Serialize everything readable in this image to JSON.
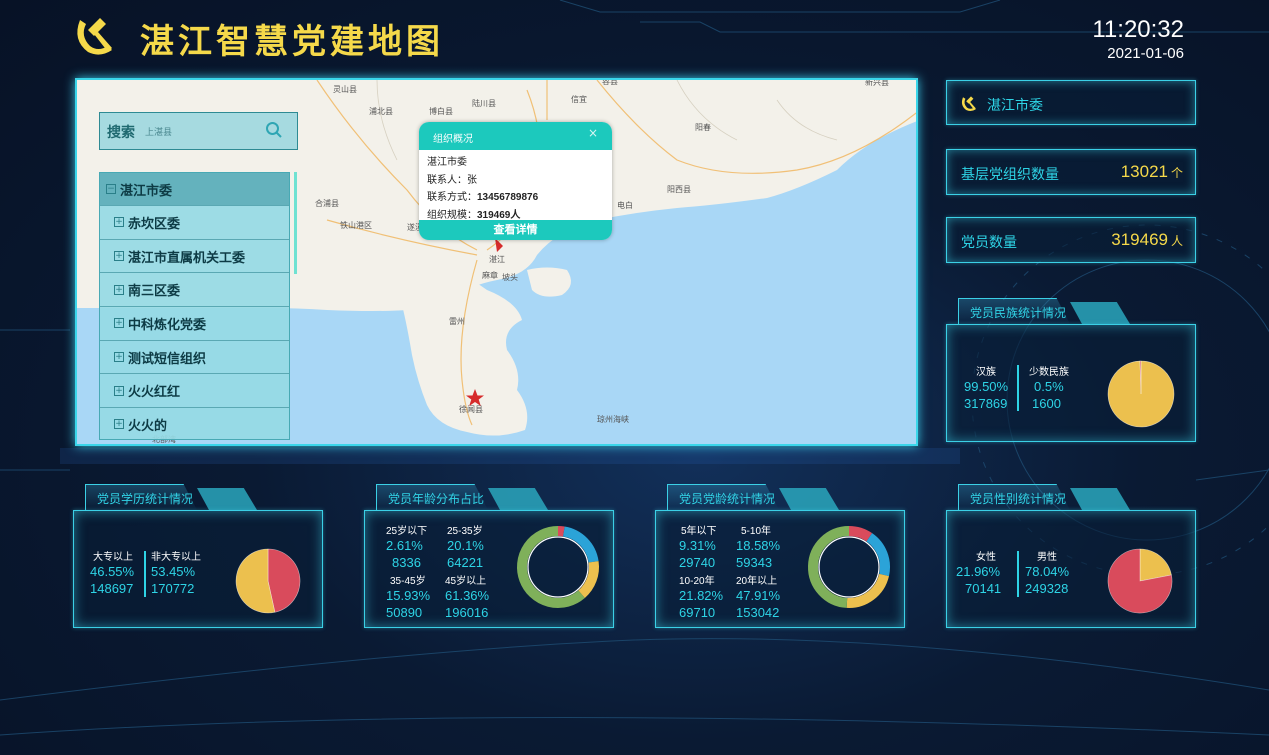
{
  "header": {
    "title": "湛江智慧党建地图",
    "time": "11:20:32",
    "date": "2021-01-06"
  },
  "colors": {
    "accent": "#2ed4e6",
    "gold": "#f5d94a",
    "pie_red": "#d94b5c",
    "pie_yellow": "#ecc04e",
    "ring_green": "#7fb05a",
    "ring_blue": "#2ba3d8"
  },
  "map": {
    "search_label": "搜索",
    "search_placeholder": "上湛县",
    "tree": {
      "root": "湛江市委",
      "items": [
        "赤坎区委",
        "湛江市直属机关工委",
        "南三区委",
        "中科炼化党委",
        "测试短信组织",
        "火火红红",
        "火火的"
      ]
    },
    "place_labels": [
      "灵山县",
      "浦北县",
      "博白县",
      "陆川县",
      "信宜",
      "容县",
      "阳春",
      "新兴县",
      "合浦县",
      "铁山港区",
      "廉江",
      "化州市",
      "茂名",
      "电白",
      "阳西县",
      "湛江",
      "麻章",
      "坡头",
      "遂溪县",
      "雷州",
      "徐闻县",
      "琼州海峡",
      "北部湾"
    ],
    "popup": {
      "header": "组织概况",
      "org": "湛江市委",
      "contact_person_label": "联系人：",
      "contact_person": "张",
      "contact_label": "联系方式：",
      "contact": "13456789876",
      "scale_label": "组织规模：",
      "scale": "319469人",
      "button": "查看详情"
    }
  },
  "sidebar": {
    "org_name": "湛江市委",
    "stats": [
      {
        "label": "基层党组织数量",
        "value": "13021",
        "unit": "个"
      },
      {
        "label": "党员数量",
        "value": "319469",
        "unit": "人"
      }
    ]
  },
  "charts": {
    "ethnicity": {
      "title": "党员民族统计情况",
      "cells": [
        {
          "label": "汉族",
          "pct": "99.50%",
          "count": "317869"
        },
        {
          "label": "少数民族",
          "pct": "0.5%",
          "count": "1600"
        }
      ]
    },
    "education": {
      "title": "党员学历统计情况",
      "cells": [
        {
          "label": "大专以上",
          "pct": "46.55%",
          "count": "148697"
        },
        {
          "label": "非大专以上",
          "pct": "53.45%",
          "count": "170772"
        }
      ]
    },
    "age": {
      "title": "党员年龄分布占比",
      "cells": [
        {
          "label": "25岁以下",
          "pct": "2.61%",
          "count": "8336"
        },
        {
          "label": "25-35岁",
          "pct": "20.1%",
          "count": "64221"
        },
        {
          "label": "35-45岁",
          "pct": "15.93%",
          "count": "50890"
        },
        {
          "label": "45岁以上",
          "pct": "61.36%",
          "count": "196016"
        }
      ]
    },
    "party_age": {
      "title": "党员党龄统计情况",
      "cells": [
        {
          "label": "5年以下",
          "pct": "9.31%",
          "count": "29740"
        },
        {
          "label": "5-10年",
          "pct": "18.58%",
          "count": "59343"
        },
        {
          "label": "10-20年",
          "pct": "21.82%",
          "count": "69710"
        },
        {
          "label": "20年以上",
          "pct": "47.91%",
          "count": "153042"
        }
      ]
    },
    "gender": {
      "title": "党员性别统计情况",
      "cells": [
        {
          "label": "女性",
          "pct": "21.96%",
          "count": "70141"
        },
        {
          "label": "男性",
          "pct": "78.04%",
          "count": "249328"
        }
      ]
    }
  },
  "chart_data": [
    {
      "type": "pie",
      "categories": [
        "汉族",
        "少数民族"
      ],
      "values": [
        99.5,
        0.5
      ]
    },
    {
      "type": "pie",
      "categories": [
        "大专以上",
        "非大专以上"
      ],
      "values": [
        46.55,
        53.45
      ]
    },
    {
      "type": "pie",
      "categories": [
        "25岁以下",
        "25-35岁",
        "35-45岁",
        "45岁以上"
      ],
      "values": [
        2.61,
        20.1,
        15.93,
        61.36
      ]
    },
    {
      "type": "pie",
      "categories": [
        "5年以下",
        "5-10年",
        "10-20年",
        "20年以上"
      ],
      "values": [
        9.31,
        18.58,
        21.82,
        47.91
      ]
    },
    {
      "type": "pie",
      "categories": [
        "女性",
        "男性"
      ],
      "values": [
        21.96,
        78.04
      ]
    }
  ]
}
